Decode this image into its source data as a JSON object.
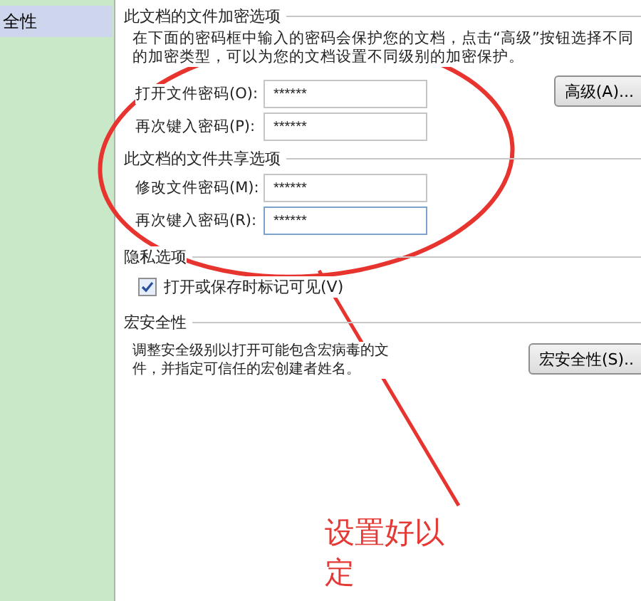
{
  "sidebar": {
    "items": [
      {
        "label": "全性",
        "selected": true
      }
    ]
  },
  "encryption": {
    "title": "此文档的文件加密选项",
    "description": "在下面的密码框中输入的密码会保护您的文档，点击“高级”按钮选择不同的加密类型，可以为您的文档设置不同级别的加密保护。",
    "fields": [
      {
        "label": "打开文件密码(O):",
        "value": "******"
      },
      {
        "label": "再次键入密码(P):",
        "value": "******"
      }
    ],
    "button": "高级(A)..."
  },
  "sharing": {
    "title": "此文档的文件共享选项",
    "fields": [
      {
        "label": "修改文件密码(M):",
        "value": "******"
      },
      {
        "label": "再次键入密码(R):",
        "value": "******"
      }
    ]
  },
  "privacy": {
    "title": "隐私选项",
    "checkbox": {
      "label": "打开或保存时标记可见(V)",
      "checked": true
    }
  },
  "macro": {
    "title": "宏安全性",
    "description": "调整安全级别以打开可能包含宏病毒的文件，并指定可信任的宏创建者姓名。",
    "button": "宏安全性(S).."
  },
  "annotation": {
    "lines": [
      "设置好以",
      "定"
    ]
  }
}
